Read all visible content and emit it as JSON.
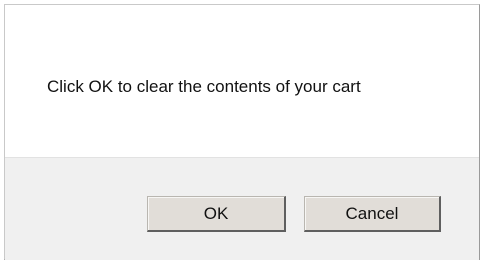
{
  "dialog": {
    "message": "Click OK to clear the contents of your cart",
    "ok_label": "OK",
    "cancel_label": "Cancel"
  }
}
